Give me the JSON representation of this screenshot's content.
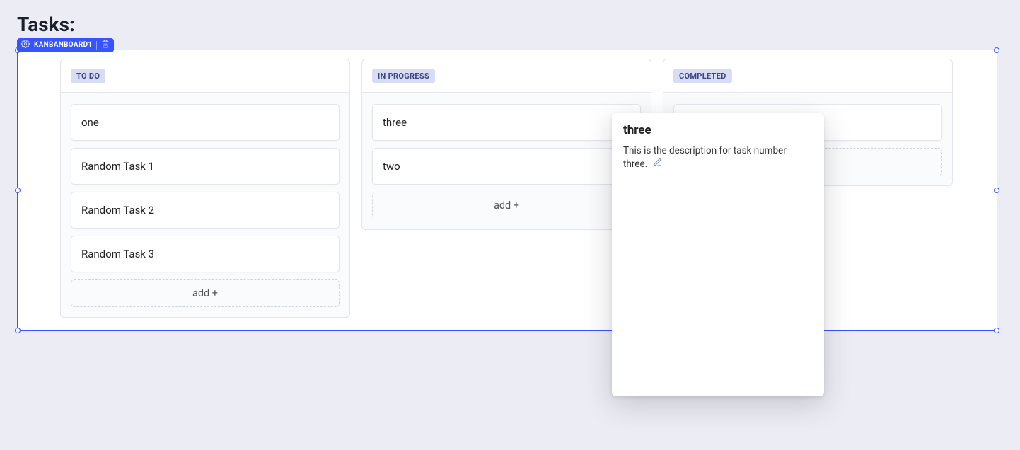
{
  "pageTitle": "Tasks:",
  "widgetHandle": {
    "label": "KANBANBOARD1"
  },
  "columns": [
    {
      "badge": "TO DO",
      "cards": [
        "one",
        "Random Task 1",
        "Random Task 2",
        "Random Task 3"
      ],
      "addLabel": "add +"
    },
    {
      "badge": "IN PROGRESS",
      "cards": [
        "three",
        "two"
      ],
      "addLabel": "add +"
    },
    {
      "badge": "COMPLETED",
      "cards": [],
      "addLabel": "add +"
    }
  ],
  "popover": {
    "title": "three",
    "description": "This is the description for task number three."
  }
}
